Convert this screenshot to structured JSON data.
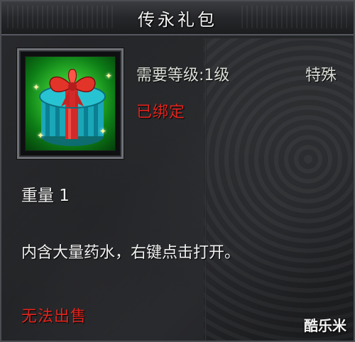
{
  "tooltip": {
    "title": "传永礼包",
    "item_icon": "gift-box-icon",
    "required_level": "需要等级:1级",
    "item_type": "特殊",
    "bind_status": "已绑定",
    "weight": "重量 1",
    "description": "内含大量药水，右键点击打开。",
    "sell_status": "无法出售"
  },
  "watermark": "酷乐米",
  "colors": {
    "background": "#1c1d1f",
    "title_text": "#f2f2f2",
    "normal_text": "#d9dcd6",
    "warning_red": "#e3241d",
    "icon_glow": "#36c531"
  }
}
